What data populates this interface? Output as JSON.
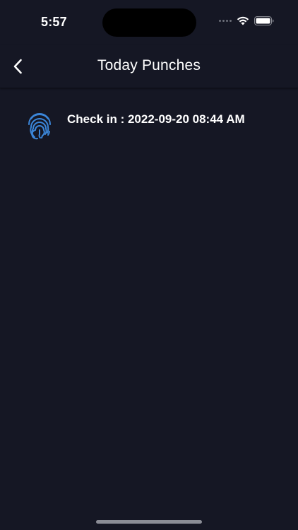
{
  "status_bar": {
    "time": "5:57"
  },
  "header": {
    "title": "Today Punches"
  },
  "punches": [
    {
      "label": "Check in : 2022-09-20 08:44 AM",
      "icon": "fingerprint-icon"
    }
  ],
  "colors": {
    "background": "#151724",
    "accent": "#3b86d9",
    "text": "#ffffff"
  }
}
